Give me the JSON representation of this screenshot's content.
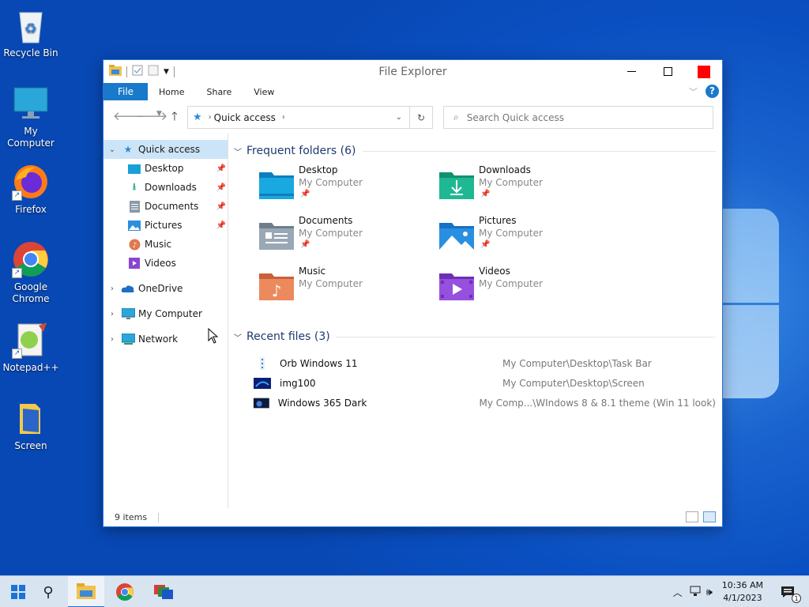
{
  "desktop": {
    "icons": [
      {
        "label": "Recycle Bin",
        "icon": "recycle-bin-icon"
      },
      {
        "label": "My Computer",
        "icon": "monitor-icon"
      },
      {
        "label": "Firefox",
        "icon": "firefox-icon"
      },
      {
        "label": "Google Chrome",
        "icon": "chrome-icon"
      },
      {
        "label": "Notepad++",
        "icon": "notepadpp-icon"
      },
      {
        "label": "Screen",
        "icon": "screen-folder-icon"
      }
    ]
  },
  "window": {
    "title": "File Explorer",
    "ribbon": {
      "tabs": [
        "File",
        "Home",
        "Share",
        "View"
      ]
    },
    "address": {
      "crumb": "Quick access"
    },
    "search": {
      "placeholder": "Search Quick access"
    },
    "nav_pane": {
      "quick_access": "Quick access",
      "pinned": [
        "Desktop",
        "Downloads",
        "Documents",
        "Pictures"
      ],
      "unpinned": [
        "Music",
        "Videos"
      ],
      "onedrive": "OneDrive",
      "my_computer": "My Computer",
      "network": "Network"
    },
    "frequent": {
      "heading": "Frequent folders (6)",
      "items": [
        {
          "name": "Desktop",
          "location": "My Computer",
          "pinned": true,
          "color": "#1aa0d8"
        },
        {
          "name": "Downloads",
          "location": "My Computer",
          "pinned": true,
          "color": "#1eae8a"
        },
        {
          "name": "Documents",
          "location": "My Computer",
          "pinned": true,
          "color": "#8c9aa8"
        },
        {
          "name": "Pictures",
          "location": "My Computer",
          "pinned": true,
          "color": "#2a8fe0"
        },
        {
          "name": "Music",
          "location": "My Computer",
          "pinned": false,
          "color": "#e0784e"
        },
        {
          "name": "Videos",
          "location": "My Computer",
          "pinned": false,
          "color": "#8a45d0"
        }
      ]
    },
    "recent": {
      "heading": "Recent files (3)",
      "items": [
        {
          "name": "Orb Windows 11",
          "path": "My Computer\\Desktop\\Task Bar"
        },
        {
          "name": "img100",
          "path": "My Computer\\Desktop\\Screen"
        },
        {
          "name": "Windows 365 Dark",
          "path": "My Comp...\\WIndows 8 & 8.1 theme (Win 11 look)"
        }
      ]
    },
    "status": {
      "items": "9 items"
    }
  },
  "taskbar": {
    "time": "10:36 AM",
    "date": "4/1/2023",
    "notifications": "1"
  }
}
